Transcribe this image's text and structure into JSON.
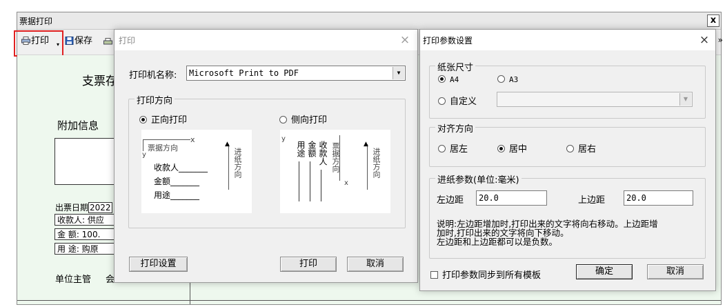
{
  "main_window": {
    "title": "票据打印",
    "close_glyph": "x",
    "toolbar": {
      "print_label": "打印",
      "save_label": "保存",
      "print_icon": "printer-icon",
      "save_icon": "floppy-disk-icon",
      "overflow_glyph": "»"
    },
    "canvas": {
      "heading": "支票存",
      "extra_info_label": "附加信息",
      "issue_date_label": "出票日期",
      "issue_date_value": "2022",
      "payee_row": "收款人: 供应",
      "amount_row": "金  额: 100.",
      "purpose_row": "用  途: 购原",
      "footer_left": "单位主管",
      "footer_right": "会"
    }
  },
  "print_dialog": {
    "title": "打印",
    "close_glyph": "×",
    "printer_name_label": "打印机名称:",
    "printer_name_value": "Microsoft Print to PDF",
    "orientation_group_label": "打印方向",
    "portrait_label": "正向打印",
    "landscape_label": "侧向打印",
    "portrait_selected": true,
    "preview_portrait": {
      "direction_label": "票据方向",
      "x_axis": "x",
      "y_axis": "y",
      "payee": "收款人_______",
      "amount": "金额_______",
      "purpose": "用途_______",
      "feed_label": "进纸方向"
    },
    "preview_landscape": {
      "direction_label": "票据方向",
      "x_axis": "x",
      "y_axis": "y",
      "payee": "收款人",
      "amount": "金额",
      "purpose": "用途",
      "feed_label": "进纸方向"
    },
    "buttons": {
      "settings": "打印设置",
      "print": "打印",
      "cancel": "取消"
    }
  },
  "params_dialog": {
    "title": "打印参数设置",
    "close_glyph": "×",
    "paper_group_label": "纸张尺寸",
    "paper_options": {
      "a4": "A4",
      "a3": "A3",
      "custom": "自定义"
    },
    "paper_selected": "A4",
    "align_group_label": "对齐方向",
    "align_options": {
      "left": "居左",
      "center": "居中",
      "right": "居右"
    },
    "align_selected": "居中",
    "feed_group_label": "进纸参数(单位:毫米)",
    "left_margin_label": "左边距",
    "left_margin_value": "20.0",
    "top_margin_label": "上边距",
    "top_margin_value": "20.0",
    "note_line1": "说明:左边距增加时,打印出来的文字将向右移动。上边距增",
    "note_line2": "加时,打印出来的文字将向下移动。",
    "note_line3": "左边距和上边距都可以是负数。",
    "sync_label": "打印参数同步到所有模板",
    "sync_checked": false,
    "buttons": {
      "ok": "确定",
      "cancel": "取消"
    }
  },
  "colors": {
    "highlight": "#e02020",
    "canvas_bg": "#eef8ee",
    "dialog_bg": "#f0f0f0"
  }
}
